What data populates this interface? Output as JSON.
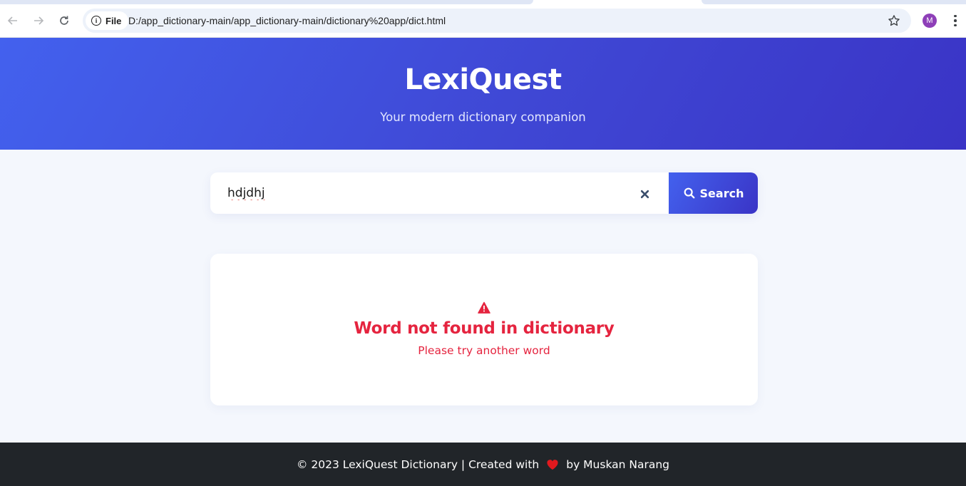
{
  "browser": {
    "chip_label": "File",
    "url": "D:/app_dictionary-main/app_dictionary-main/dictionary%20app/dict.html",
    "profile_initial": "M"
  },
  "hero": {
    "title": "LexiQuest",
    "subtitle": "Your modern dictionary companion"
  },
  "search": {
    "value": "hdjdhj",
    "button_label": "Search"
  },
  "result": {
    "title": "Word not found in dictionary",
    "subtitle": "Please try another word"
  },
  "footer": {
    "text_before": "© 2023 LexiQuest Dictionary | Created with",
    "text_after": "by Muskan Narang"
  },
  "colors": {
    "brand_primary": "#4361ee",
    "brand_secondary": "#3a34c6",
    "error": "#e5243f",
    "footer_bg": "#212529"
  }
}
